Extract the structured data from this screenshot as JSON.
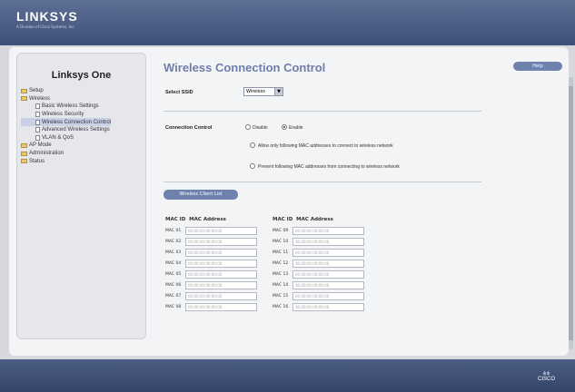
{
  "header": {
    "logo": "LINKSYS",
    "logo_sub": "A Division of Cisco Systems, Inc."
  },
  "sidebar": {
    "brand": "Linksys One",
    "items": [
      {
        "label": "Setup",
        "type": "folder",
        "indent": 0
      },
      {
        "label": "Wireless",
        "type": "folder",
        "indent": 0
      },
      {
        "label": "Basic Wireless Settings",
        "type": "page",
        "indent": 2
      },
      {
        "label": "Wireless Security",
        "type": "page",
        "indent": 2
      },
      {
        "label": "Wireless Connection Control",
        "type": "page",
        "indent": 2,
        "selected": true
      },
      {
        "label": "Advanced Wireless Settings",
        "type": "page",
        "indent": 2
      },
      {
        "label": "VLAN & QoS",
        "type": "page",
        "indent": 2
      },
      {
        "label": "AP Mode",
        "type": "folder",
        "indent": 0
      },
      {
        "label": "Administration",
        "type": "folder",
        "indent": 0
      },
      {
        "label": "Status",
        "type": "folder",
        "indent": 0
      }
    ]
  },
  "main": {
    "title": "Wireless Connection Control",
    "help_label": "Help",
    "select_ssid_label": "Select SSID",
    "ssid_value": "Wireless",
    "connection_control_label": "Connection Control",
    "radio_disable": "Disable",
    "radio_enable": "Enable",
    "allow_text": "Allow only following MAC addresses to connect to wireless network",
    "prevent_text": "Prevent following MAC addresses from connecting to wireless network",
    "client_list_button": "Wireless Client List",
    "col_mac_id": "MAC ID",
    "col_mac_address": "MAC Address",
    "placeholder": "00:00:00:00:00:00",
    "left_rows": [
      "MAC 01",
      "MAC 02",
      "MAC 03",
      "MAC 04",
      "MAC 05",
      "MAC 06",
      "MAC 07",
      "MAC 08"
    ],
    "right_rows": [
      "MAC 09",
      "MAC 10",
      "MAC 11",
      "MAC 12",
      "MAC 13",
      "MAC 14",
      "MAC 15",
      "MAC 16"
    ]
  },
  "footer": {
    "brand": "CISCO"
  }
}
